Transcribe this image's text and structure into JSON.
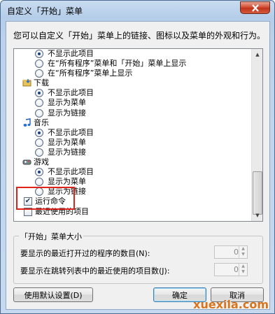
{
  "window": {
    "title": "自定义「开始」菜单"
  },
  "description": "您可以自定义「开始」菜单上的链接、图标以及菜单的外观和行为。",
  "list": {
    "rows": [
      {
        "kind": "radio",
        "checked": true,
        "label": "不显示此项目"
      },
      {
        "kind": "radio",
        "checked": false,
        "label": "在“所有程序”菜单和「开始」菜单上显示"
      },
      {
        "kind": "radio",
        "checked": false,
        "label": "在“所有程序”菜单上显示"
      },
      {
        "kind": "category",
        "icon": "folder-download-icon",
        "label": "下载"
      },
      {
        "kind": "radio",
        "checked": true,
        "label": "不显示此项目"
      },
      {
        "kind": "radio",
        "checked": false,
        "label": "显示为菜单"
      },
      {
        "kind": "radio",
        "checked": false,
        "label": "显示为链接"
      },
      {
        "kind": "category",
        "icon": "music-note-icon",
        "label": "音乐"
      },
      {
        "kind": "radio",
        "checked": true,
        "label": "不显示此项目"
      },
      {
        "kind": "radio",
        "checked": false,
        "label": "显示为菜单"
      },
      {
        "kind": "radio",
        "checked": false,
        "label": "显示为链接"
      },
      {
        "kind": "category",
        "icon": "games-icon",
        "label": "游戏"
      },
      {
        "kind": "radio",
        "checked": true,
        "label": "不显示此项目"
      },
      {
        "kind": "radio",
        "checked": false,
        "label": "显示为菜单"
      },
      {
        "kind": "radio",
        "checked": false,
        "label": "显示为链接"
      },
      {
        "kind": "checkbox",
        "checked": true,
        "label": "运行命令"
      },
      {
        "kind": "checkbox",
        "checked": false,
        "label": "最近使用的项目"
      }
    ]
  },
  "size_group": {
    "title": "「开始」菜单大小",
    "recent_programs_label": "要显示的最近打开过的程序的数目(N):",
    "recent_programs_value": "0",
    "jump_list_label": "要显示在跳转列表中的最近使用的项目数(J):",
    "jump_list_value": "0"
  },
  "buttons": {
    "defaults": "使用默认设置(D)",
    "ok": "确定",
    "cancel": "取消"
  },
  "watermark": "xuexila.com",
  "colors": {
    "highlight_box": "#e0231a",
    "close_button": "#c0321a"
  }
}
